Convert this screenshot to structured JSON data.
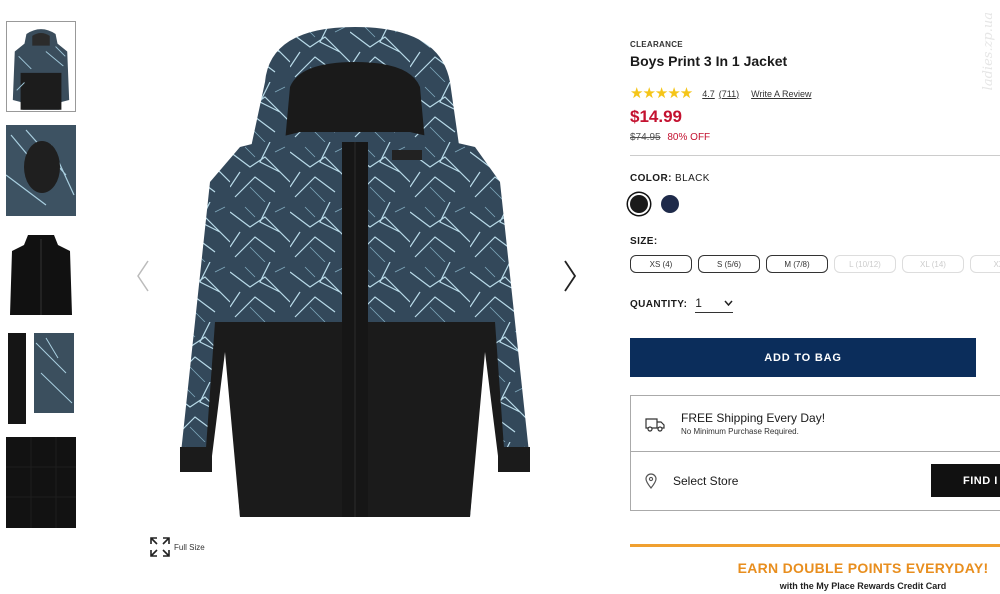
{
  "gallery": {
    "thumbnails": [
      "front",
      "collar-detail",
      "fleece-liner",
      "sleeve-detail",
      "fabric-detail"
    ],
    "full_size_label": "Full Size"
  },
  "product": {
    "tag": "CLEARANCE",
    "title": "Boys Print 3 In 1 Jacket",
    "rating": {
      "stars": "★★★★★",
      "value": "4.7",
      "count": "(711)",
      "write_review": "Write A Review"
    },
    "price": "$14.99",
    "original_price": "$74.95",
    "discount": "80% OFF"
  },
  "color": {
    "label": "COLOR:",
    "selected": "BLACK",
    "swatches": [
      {
        "name": "black",
        "hex": "#1a1a1a"
      },
      {
        "name": "navy",
        "hex": "#1e2a4a"
      }
    ]
  },
  "size": {
    "label": "SIZE:",
    "options": [
      {
        "label": "XS (4)",
        "available": true
      },
      {
        "label": "S (5/6)",
        "available": true
      },
      {
        "label": "M (7/8)",
        "available": true
      },
      {
        "label": "L (10/12)",
        "available": false
      },
      {
        "label": "XL (14)",
        "available": false
      },
      {
        "label": "XXL",
        "available": false
      }
    ]
  },
  "quantity": {
    "label": "QUANTITY:",
    "value": "1"
  },
  "add_to_bag": "ADD TO BAG",
  "shipping": {
    "title": "FREE Shipping Every Day!",
    "subtitle": "No Minimum Purchase Required.",
    "store_label": "Select Store",
    "find_button": "FIND I"
  },
  "promo": {
    "headline": "EARN DOUBLE POINTS EVERYDAY!",
    "subline": "with the My Place Rewards Credit Card"
  },
  "watermark": "ladies.zp.ua",
  "colors": {
    "price_red": "#c41230",
    "navy_button": "#0b2d5b",
    "promo_orange": "#e88e1e",
    "star_gold": "#f5c518"
  }
}
